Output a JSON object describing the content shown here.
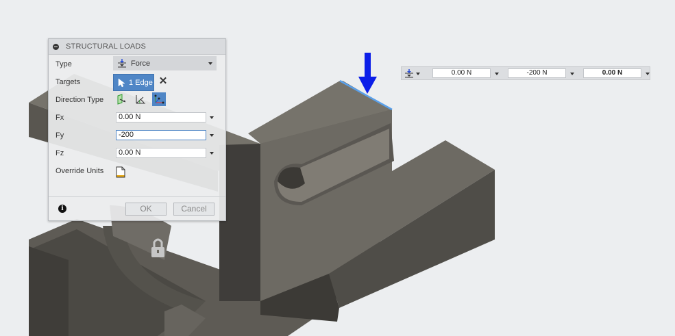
{
  "dialog": {
    "title": "STRUCTURAL LOADS",
    "type": {
      "label": "Type",
      "value": "Force"
    },
    "targets": {
      "label": "Targets",
      "value": "1 Edge"
    },
    "direction_type": {
      "label": "Direction Type"
    },
    "fx": {
      "label": "Fx",
      "value": "0.00 N"
    },
    "fy": {
      "label": "Fy",
      "value": "-200"
    },
    "fz": {
      "label": "Fz",
      "value": "0.00 N"
    },
    "override_units": {
      "label": "Override Units"
    },
    "ok_label": "OK",
    "cancel_label": "Cancel"
  },
  "toolbar": {
    "fx": "0.00 N",
    "fy": "-200 N",
    "fz": "0.00 N"
  },
  "colors": {
    "accent": "#4f86c6",
    "arrow": "#0b1ee8",
    "model_body": "#6b6860",
    "selected_edge": "#5aa0ea"
  },
  "icons": [
    "force-icon",
    "cursor-icon",
    "clear-icon",
    "normal-direction-icon",
    "angle-direction-icon",
    "vector-direction-icon",
    "override-units-icon",
    "info-icon",
    "lock-icon"
  ]
}
